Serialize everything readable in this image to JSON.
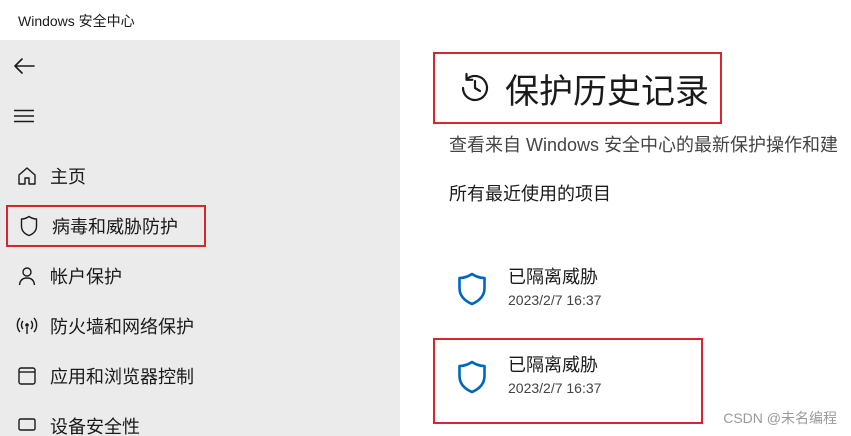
{
  "window": {
    "title": "Windows 安全中心"
  },
  "sidebar": {
    "back_icon": "arrow-left-icon",
    "menu_icon": "hamburger-icon",
    "items": [
      {
        "label": "主页",
        "icon": "home-icon"
      },
      {
        "label": "病毒和威胁防护",
        "icon": "shield-icon"
      },
      {
        "label": "帐户保护",
        "icon": "person-icon"
      },
      {
        "label": "防火墙和网络保护",
        "icon": "wifi-antenna-icon"
      },
      {
        "label": "应用和浏览器控制",
        "icon": "app-window-icon"
      },
      {
        "label": "设备安全性",
        "icon": "device-icon"
      }
    ]
  },
  "main": {
    "heading": "保护历史记录",
    "heading_icon": "history-clock-icon",
    "description": "查看来自 Windows 安全中心的最新保护操作和建",
    "section_title": "所有最近使用的项目",
    "history": [
      {
        "status": "已隔离威胁",
        "timestamp": "2023/2/7 16:37"
      },
      {
        "status": "已隔离威胁",
        "timestamp": "2023/2/7 16:37"
      }
    ]
  },
  "watermark": "CSDN @未名编程",
  "colors": {
    "accent": "#0067c0",
    "highlight_border": "#d9262c",
    "sidebar_bg": "#ebebeb"
  }
}
